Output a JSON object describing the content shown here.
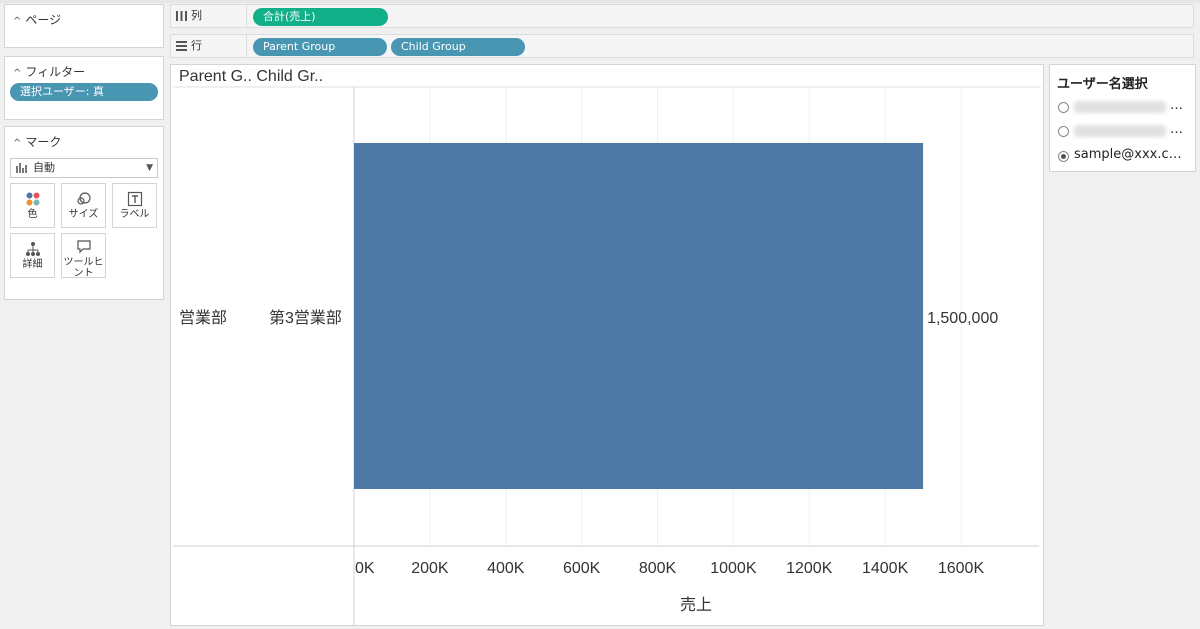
{
  "side": {
    "pages_label": "ページ",
    "filters_label": "フィルター",
    "filter_pill": "選択ユーザー: 真",
    "marks_label": "マーク",
    "mark_type": "自動",
    "mark_buttons": {
      "color": "色",
      "size": "サイズ",
      "label": "ラベル",
      "detail": "詳細",
      "tooltip_line1": "ツールヒ",
      "tooltip_line2": "ント"
    }
  },
  "shelves": {
    "columns_label": "列",
    "columns_pill": "合計(売上)",
    "rows_label": "行",
    "rows_pills": [
      "Parent Group",
      "Child Group"
    ]
  },
  "colors": {
    "measure_pill": "#12b088",
    "dimension_pill": "#4996b2",
    "bar": "#4e79a7"
  },
  "chart_data": {
    "type": "bar",
    "orientation": "horizontal",
    "header_text": "Parent G.. Child Gr..",
    "parent_category": "営業部",
    "categories": [
      "第3営業部"
    ],
    "values": [
      1500000
    ],
    "data_labels": [
      "1,500,000"
    ],
    "xlabel": "売上",
    "xlim": [
      0,
      1600000
    ],
    "xticks": [
      0,
      200000,
      400000,
      600000,
      800000,
      1000000,
      1200000,
      1400000,
      1600000
    ],
    "xtick_labels": [
      "0K",
      "200K",
      "400K",
      "600K",
      "800K",
      "1000K",
      "1200K",
      "1400K",
      "1600K"
    ],
    "grid": true
  },
  "user_select": {
    "title": "ユーザー名選択",
    "options": [
      {
        "selected": false,
        "ellipsis": "…"
      },
      {
        "selected": false,
        "ellipsis": "…"
      },
      {
        "text": "sample@xxx.c…",
        "selected": true
      }
    ]
  }
}
